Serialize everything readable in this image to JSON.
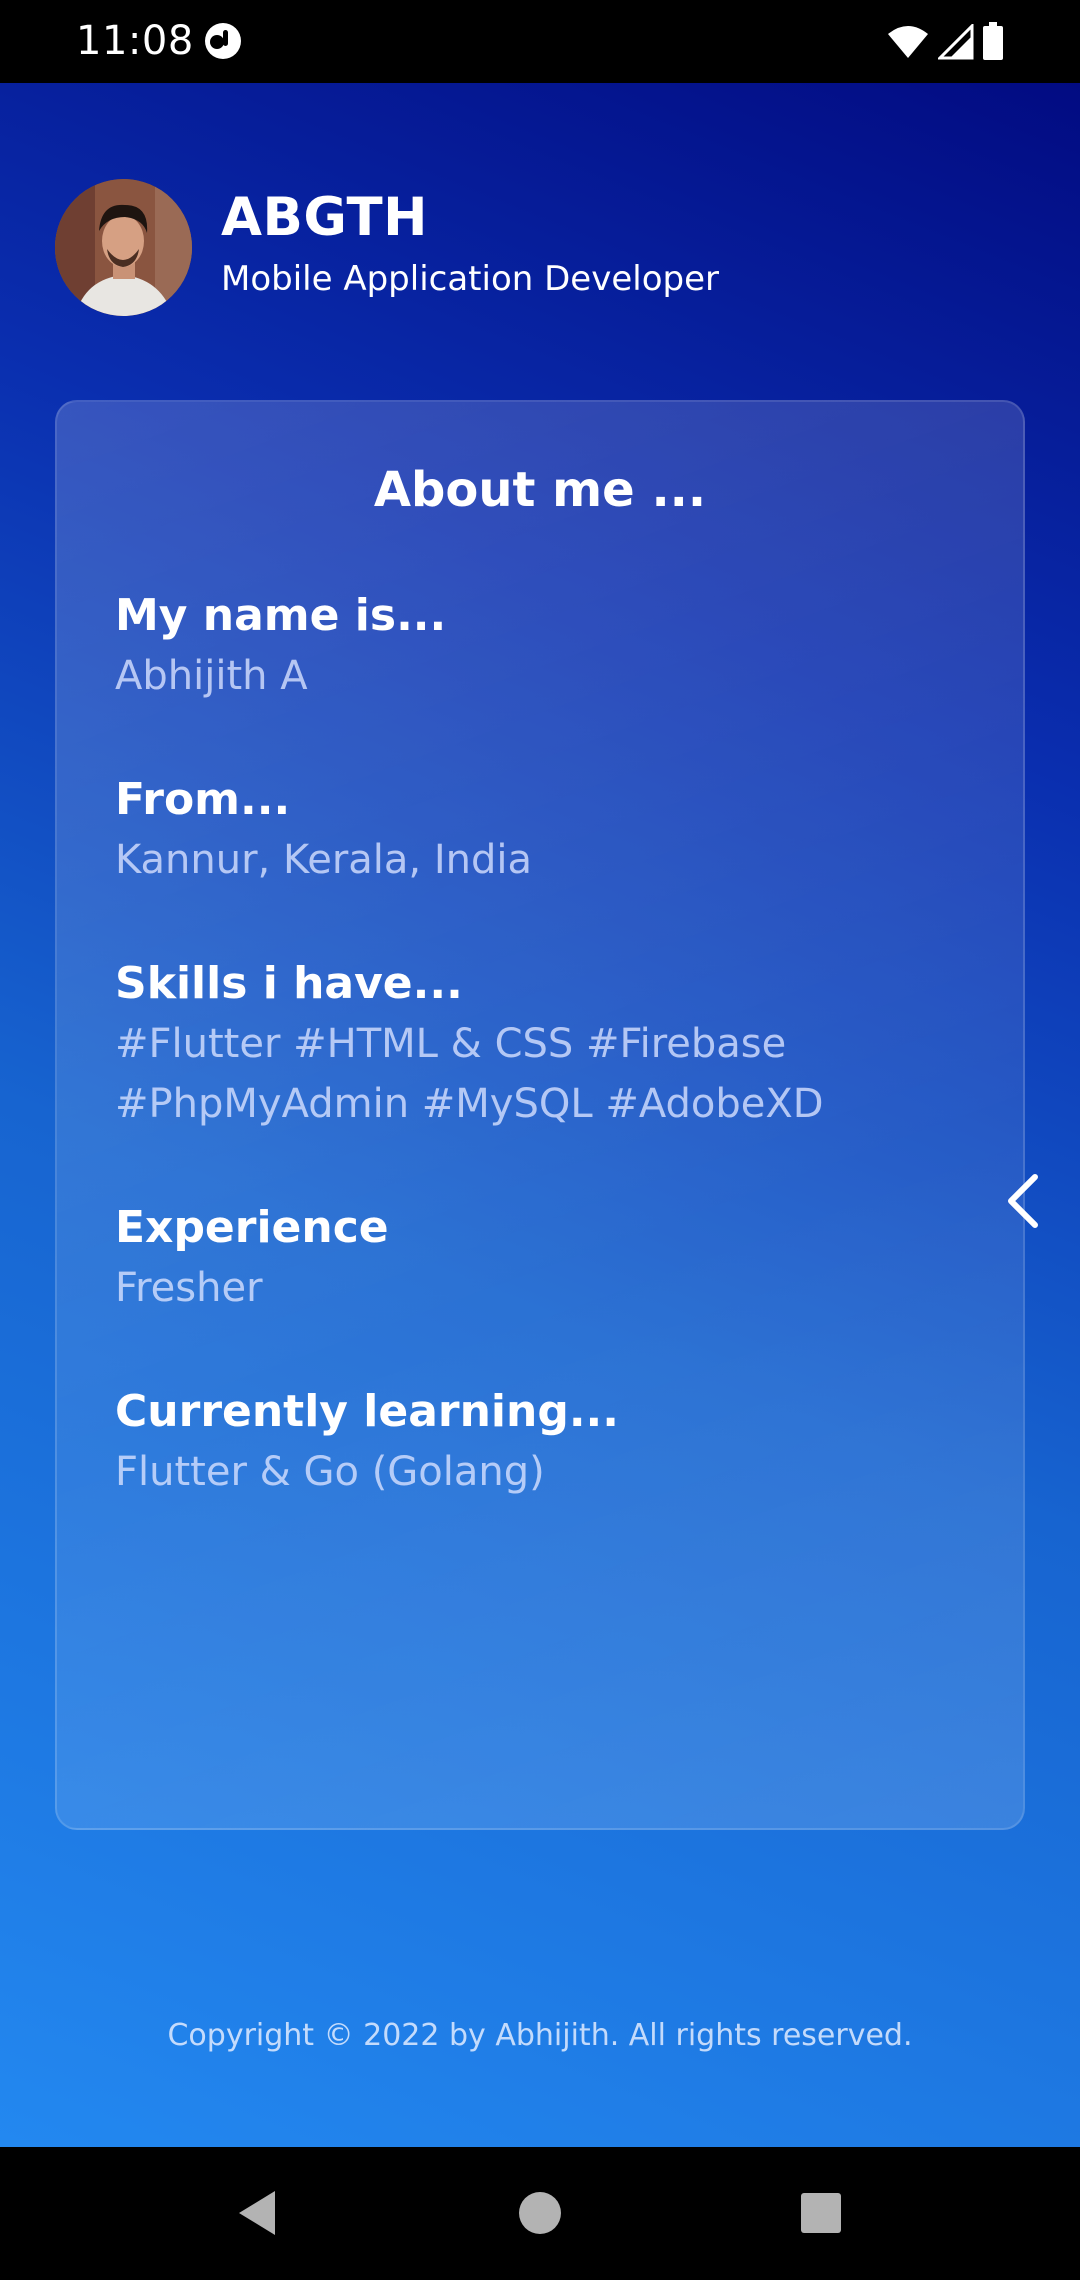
{
  "status_bar": {
    "time": "11:08",
    "icons": [
      "app-notification-icon",
      "wifi-icon",
      "cellular-signal-icon",
      "battery-icon"
    ]
  },
  "profile": {
    "name": "ABGTH",
    "role": "Mobile Application Developer",
    "avatar_icon": "profile-photo"
  },
  "about": {
    "title": "About me ...",
    "sections": [
      {
        "heading": "My name is...",
        "lines": [
          "Abhijith A"
        ]
      },
      {
        "heading": "From...",
        "lines": [
          "Kannur, Kerala, India"
        ]
      },
      {
        "heading": "Skills i have...",
        "lines": [
          "#Flutter #HTML & CSS #Firebase",
          "#PhpMyAdmin #MySQL #AdobeXD"
        ]
      },
      {
        "heading": "Experience",
        "lines": [
          "Fresher"
        ]
      },
      {
        "heading": "Currently learning...",
        "lines": [
          "Flutter & Go (Golang)"
        ]
      }
    ]
  },
  "side_nav": {
    "icon": "chevron-left-icon"
  },
  "footer": {
    "copyright": "Copyright © 2022 by Abhijith. All rights reserved."
  },
  "system_nav": {
    "buttons": [
      "back-triangle-icon",
      "home-circle-icon",
      "recents-square-icon"
    ]
  },
  "colors": {
    "gradient_top": "#020b82",
    "gradient_mid": "#1764d0",
    "gradient_bottom": "#2388f0",
    "text_primary": "#ffffff",
    "text_secondary": "#d7e1ff"
  }
}
